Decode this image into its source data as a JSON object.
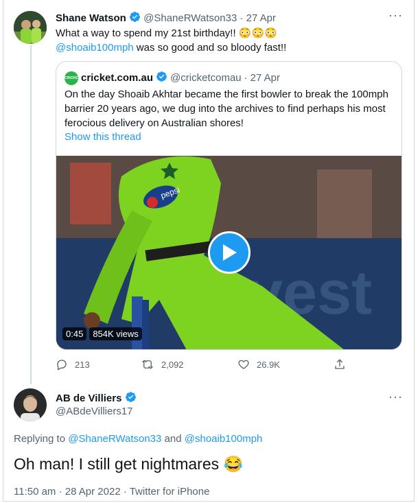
{
  "colors": {
    "accent": "#1d9bf0",
    "text": "#0f1419",
    "muted": "#536471",
    "border": "#cfd9de",
    "pitch_green": "#7ed321",
    "play_blue": "#1d9bf0"
  },
  "main_tweet": {
    "name": "Shane Watson",
    "handle": "@ShaneRWatson33",
    "separator": "·",
    "date": "27 Apr",
    "text_line1": "What a way to spend my 21st birthday!! 😳😳😳",
    "mention": "@shoaib100mph",
    "text_line2_rest": " was so good and so bloody fast!!",
    "more_icon": "more-horizontal-icon"
  },
  "quoted_tweet": {
    "name": "cricket.com.au",
    "handle": "@cricketcomau",
    "separator": "·",
    "date": "27 Apr",
    "text": "On the day Shoaib Akhtar became the first bowler to break the 100mph barrier 20 years ago, we dug into the archives to find perhaps his most ferocious delivery on Australian shores!",
    "show_thread": "Show this thread",
    "video": {
      "duration": "0:45",
      "views": "854K views"
    }
  },
  "actions": {
    "replies": "213",
    "retweets": "2,092",
    "likes": "26.9K"
  },
  "reply_tweet": {
    "name": "AB de Villiers",
    "handle": "@ABdeVilliers17",
    "replying_prefix": "Replying to ",
    "replying_user1": "@ShaneRWatson33",
    "replying_and": " and ",
    "replying_user2": "@shoaib100mph",
    "text": "Oh man! I still get nightmares 😂",
    "timestamp": "11:50 am · 28 Apr 2022 · Twitter for iPhone"
  }
}
